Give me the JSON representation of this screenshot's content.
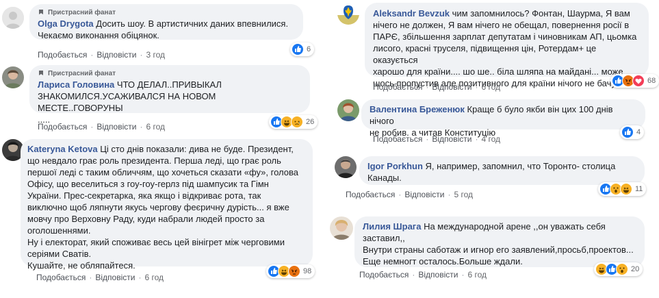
{
  "badge_label": "Пристрасний фанат",
  "like_label": "Подобається",
  "reply_label": "Відповісти",
  "dot": "·",
  "comments": [
    {
      "author": "Olga Drygota",
      "badge": true,
      "text": "Досить шоу. В артистичних даних впевнилися.\nЧекаємо виконання обіцянок.",
      "time": "3 год",
      "reactions": [
        "like"
      ],
      "count": "6"
    },
    {
      "author": "Лариса Головина",
      "badge": true,
      "text": "ЧТО ДЕЛАЛ..ПРИВЫКАЛ\nЗНАКОМИЛСЯ.УСАЖИВАЛСЯ НА НОВОМ МЕСТЕ..ГОВОРУНЫ\n.....",
      "time": "6 год",
      "reactions": [
        "like",
        "haha",
        "sad"
      ],
      "count": "26"
    },
    {
      "author": "Kateryna Ketova",
      "badge": false,
      "text": "Ці сто днів показали: дива не буде. Президент,\nщо невдало грає роль президента. Перша леді, що грає роль\nпершої леді с таким обличчям, що хочеться сказати «фу», голова\nОфісу, що веселиться з гоу-гоу-герлз під шампусик та Гімн\nУкраїни. Прес-секретарка, яка якщо і відкриває рота, так\nвиключно щоб ляпнути якусь чергову феєричну дурість... я вже\nмовчу про Верховну Раду, куди набрали людей просто за\nоголошеннями.\nНу і електорат, який споживає весь цей вінігрет між черговими\nсеріями Сватів.\nКушайте, не обляпайтеся.",
      "time": "6 год",
      "reactions": [
        "like",
        "haha",
        "angry"
      ],
      "count": "98"
    },
    {
      "author": "Aleksandr Bevzuk",
      "badge": false,
      "text": "чим запомнилось? Фонтан, Шаурма, Я вам\nнічего не должен, Я вам нічего не обещал, повернення росії в\nПАРЄ, збільшення зарплат депутатам і чиновникам АП, цьомка\nлисого, красні труселя, підвищення цін, Ротердам+ це оказується\nхарошо для країни.... шо ше.. біла шляпа на майдані... може\nшось пропустив але позитивного для країни нічого не бачу.....",
      "time": "6 год",
      "reactions": [
        "like",
        "angry",
        "love"
      ],
      "count": "68"
    },
    {
      "author": "Валентина Бреженюк",
      "badge": false,
      "text": "Краще б було якби він цих 100 днів нічого\nне робив. а читав Конституцію",
      "time": "4 год",
      "reactions": [
        "like"
      ],
      "count": "4"
    },
    {
      "author": "Igor Porkhun",
      "badge": false,
      "text": "Я, например, запомнил, что Торонто- столица\nКанады.",
      "time": "5 год",
      "reactions": [
        "like",
        "wow",
        "haha"
      ],
      "count": "11"
    },
    {
      "author": "Лилия Шрага",
      "badge": false,
      "text": "На международной арене ,,он уважать себя\nзаставил,,\nВнутри страны саботаж и игнор его заявлений,просьб,проектов...\nЕще немногт осталось.Больше ждали.",
      "time": "6 год",
      "reactions": [
        "haha",
        "like",
        "wow"
      ],
      "count": "20"
    }
  ]
}
